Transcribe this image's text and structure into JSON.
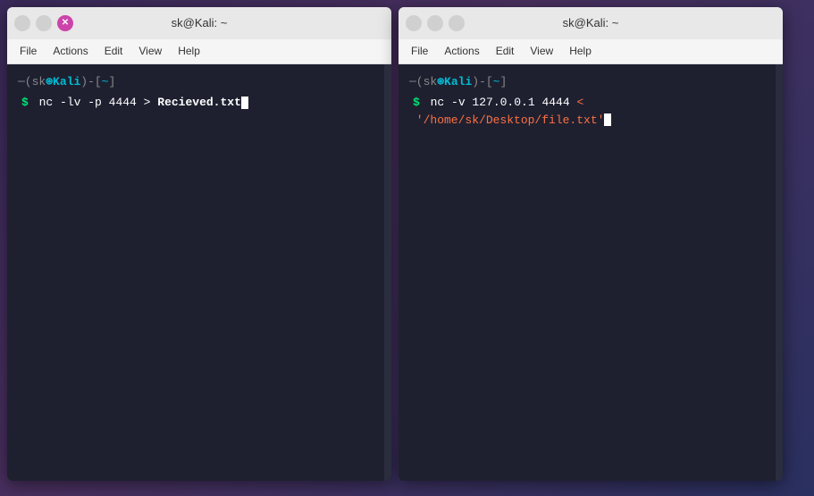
{
  "terminals": [
    {
      "id": "terminal-left",
      "title": "sk@Kali: ~",
      "controls": {
        "minimize_label": "",
        "maximize_label": "",
        "close_label": "✕"
      },
      "menu": [
        "File",
        "Actions",
        "Edit",
        "View",
        "Help"
      ],
      "prompt_user": "sk",
      "prompt_symbol": "⊛",
      "prompt_host": "Kali",
      "prompt_dir": "~",
      "command_line1_prefix": "─(sk",
      "command_line1_symbol": "⊛",
      "command_line1_host": " Kali",
      "command_line1_dir": "-[~]",
      "command_line2": "$ nc -lv -p 4444 > Recieved.txt",
      "command_parts": {
        "dollar": "$",
        "cmd": "nc",
        "flags": "-lv",
        "flag_p": "-p",
        "port": "4444",
        "redirect": ">",
        "filename": "Recieved.txt"
      }
    },
    {
      "id": "terminal-right",
      "title": "sk@Kali: ~",
      "controls": {
        "minimize_label": "",
        "maximize_label": "",
        "close_label": ""
      },
      "menu": [
        "File",
        "Actions",
        "Edit",
        "View",
        "Help"
      ],
      "command_parts": {
        "dollar": "$",
        "cmd": "nc",
        "flag_v": "-v",
        "ip": "127.0.0.1",
        "port": "4444",
        "redirect": "<",
        "filepath": "'/home/sk/Desktop/file.txt'"
      }
    }
  ]
}
